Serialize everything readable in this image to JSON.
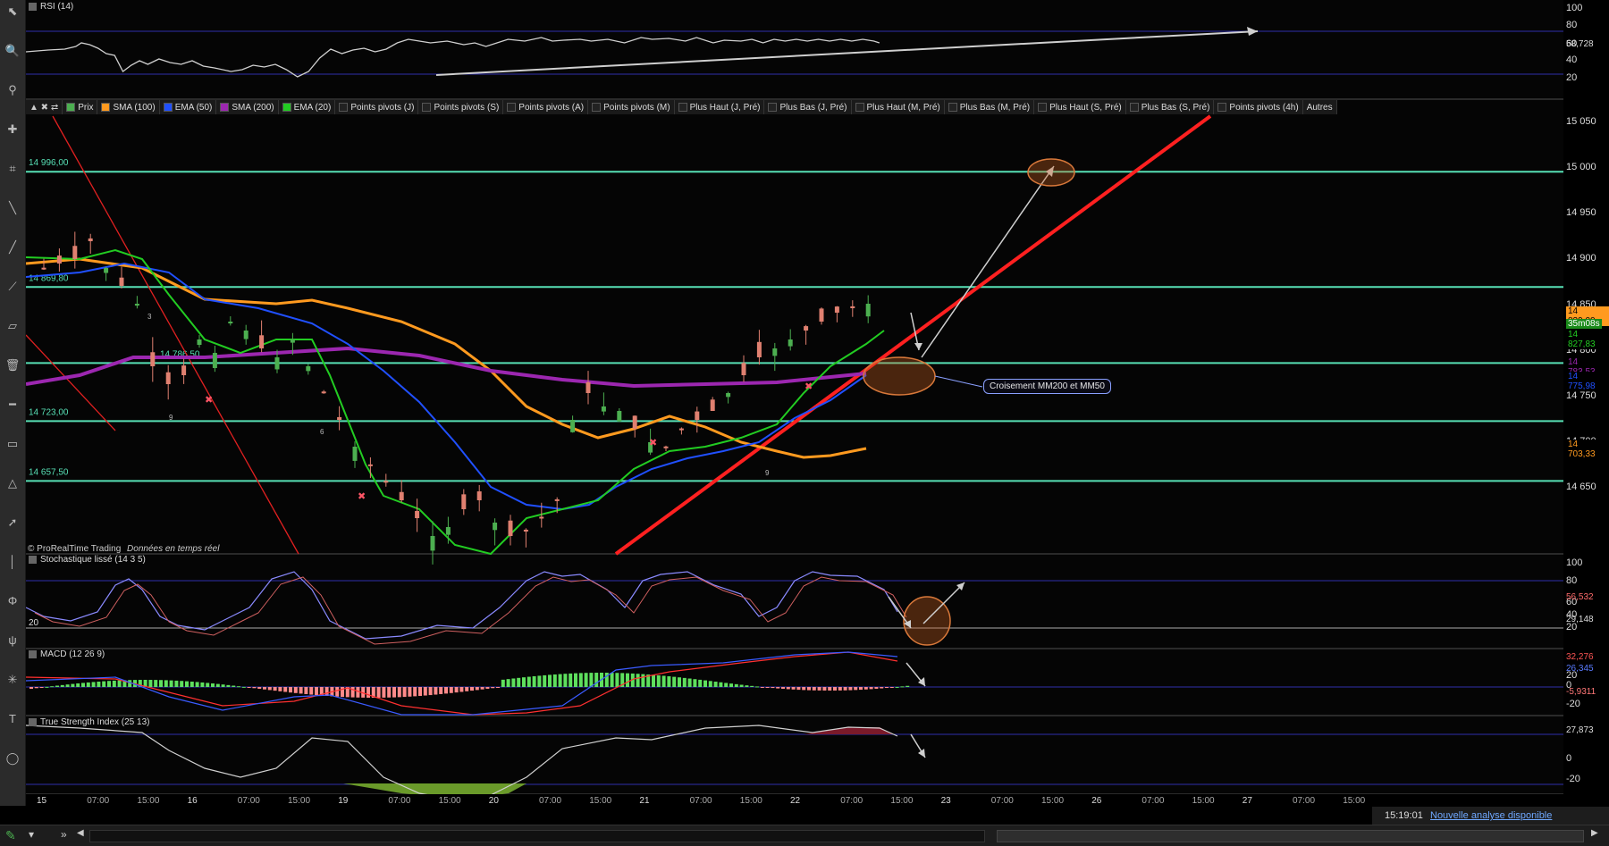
{
  "toolbar": {
    "icons": [
      "cursor-icon",
      "zoom-icon",
      "magnet-icon",
      "crosshair-icon",
      "measure-icon",
      "line-icon",
      "trend-line-icon",
      "ray-icon",
      "channel-icon",
      "trash-icon",
      "horizontal-line-icon",
      "rectangle-icon",
      "triangle-icon",
      "arrow-icon",
      "vertical-line-icon",
      "fib-icon",
      "pitchfork-icon",
      "gann-icon",
      "text-icon",
      "ellipse-icon"
    ]
  },
  "rsi_panel": {
    "title": "RSI (14)",
    "axis": [
      "100",
      "80",
      "60",
      "40",
      "20"
    ],
    "value_label": "58,728"
  },
  "series_bar": {
    "items": [
      {
        "label": "Prix",
        "color": "#4caf50"
      },
      {
        "label": "SMA (100)",
        "color": "#ff9a1f"
      },
      {
        "label": "EMA (50)",
        "color": "#2050ff"
      },
      {
        "label": "SMA (200)",
        "color": "#9c27b0"
      },
      {
        "label": "EMA (20)",
        "color": "#22cc22"
      },
      {
        "label": "Points pivots (J)",
        "color": "#222222"
      },
      {
        "label": "Points pivots (S)",
        "color": "#222222"
      },
      {
        "label": "Points pivots (A)",
        "color": "#222222"
      },
      {
        "label": "Points pivots (M)",
        "color": "#222222"
      },
      {
        "label": "Plus Haut (J, Pré)",
        "color": "#222222"
      },
      {
        "label": "Plus Bas (J, Pré)",
        "color": "#222222"
      },
      {
        "label": "Plus Haut (M, Pré)",
        "color": "#222222"
      },
      {
        "label": "Plus Bas (M, Pré)",
        "color": "#222222"
      },
      {
        "label": "Plus Haut (S, Pré)",
        "color": "#222222"
      },
      {
        "label": "Plus Bas (S, Pré)",
        "color": "#222222"
      },
      {
        "label": "Points pivots (4h)",
        "color": "#222222"
      }
    ],
    "more_label": "Autres"
  },
  "price_panel": {
    "axis": [
      "15 050",
      "15 000",
      "14 950",
      "14 900",
      "14 850",
      "14 800",
      "14 750",
      "14 700",
      "14 650"
    ],
    "levels": [
      {
        "label": "14 996,00",
        "value": 14996
      },
      {
        "label": "14 869,80",
        "value": 14869.8
      },
      {
        "label": "14 786,50",
        "value": 14786.5
      },
      {
        "label": "14 723,00",
        "value": 14723
      },
      {
        "label": "14 657,50",
        "value": 14657.5
      }
    ],
    "tags": [
      {
        "text": "14 839,00",
        "bg": "#ff9a1f",
        "fg": "#000"
      },
      {
        "text": "35m08s",
        "bg": "#1a8a1a",
        "fg": "#fff"
      },
      {
        "text": "14 827,83",
        "bg": "#000",
        "fg": "#22cc22"
      },
      {
        "text": "14 783,53",
        "bg": "#000",
        "fg": "#9c27b0"
      },
      {
        "text": "14 775,98",
        "bg": "#000",
        "fg": "#2050ff"
      },
      {
        "text": "14 703,33",
        "bg": "#000",
        "fg": "#ff9a1f"
      }
    ],
    "callout": "Croisement MM200 et MM50",
    "watermark": "© ProRealTime Trading",
    "watermark_sub": "Données en temps réel",
    "count_marks": [
      "3",
      "9",
      "6",
      "9"
    ]
  },
  "stoch_panel": {
    "title": "Stochastique lissé (14 3 5)",
    "axis": [
      "100",
      "80",
      "60",
      "40",
      "20"
    ],
    "values": [
      "56,532",
      "29,148"
    ],
    "level_label": "20"
  },
  "macd_panel": {
    "title": "MACD (12 26 9)",
    "axis": [
      "20",
      "0",
      "-20"
    ],
    "values": [
      "32,276",
      "26,345",
      "-5,9311"
    ]
  },
  "tsi_panel": {
    "title": "True Strength Index (25 13)",
    "axis": [
      "0",
      "-20"
    ],
    "values": [
      "27,873"
    ]
  },
  "time_axis": [
    "15",
    "07:00",
    "15:00",
    "16",
    "07:00",
    "15:00",
    "19",
    "07:00",
    "15:00",
    "20",
    "07:00",
    "15:00",
    "21",
    "07:00",
    "15:00",
    "22",
    "07:00",
    "15:00",
    "23",
    "07:00",
    "15:00",
    "26",
    "07:00",
    "15:00",
    "27",
    "07:00",
    "15:00"
  ],
  "status": {
    "time": "15:19:01",
    "link": "Nouvelle analyse disponible"
  }
}
